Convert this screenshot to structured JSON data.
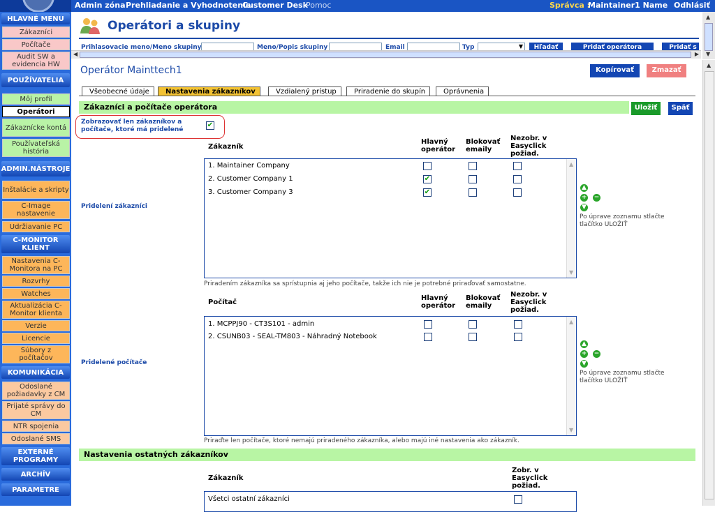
{
  "topbar": {
    "nav": [
      "Admin zóna",
      "Prehliadanie a Vyhodnotenie",
      "Customer Desk",
      "Pomoc"
    ],
    "admin_label": "Správca :",
    "admin_name": "Maintainer1 Name",
    "logout": "Odhlásiť"
  },
  "sidebar": {
    "hlavne_menu": "HLAVNÉ MENU",
    "zakaznici": "Zákazníci",
    "pocitace": "Počítače",
    "audit": "Audit SW a evidencia HW",
    "pouzivatelia": "POUŽÍVATELIA",
    "moj_profil": "Môj profil",
    "operatori": "Operátori",
    "zakaznicke_konta": "Zákaznícke kontá",
    "pouz_historia": "Používateľská história",
    "admin_nastroje": "ADMIN.NÁSTROJE",
    "instalacie": "Inštalácie a skripty",
    "cimage": "C-Image nastavenie",
    "udrziavanie": "Udržiavanie PC",
    "cmonitor_klient": "C-MONITOR KLIENT",
    "nastavenia_cm": "Nastavenia C-Monitora na PC",
    "rozvrhy": "Rozvrhy",
    "watches": "Watches",
    "aktualizacia": "Aktualizácia C-Monitor klienta",
    "verzie": "Verzie",
    "licencie": "Licencie",
    "subory": "Súbory z počítačov",
    "komunikacia": "KOMUNIKÁCIA",
    "odoslane_poziadavky": "Odoslané požiadavky z CM",
    "prijate_spravy": "Prijaté správy do CM",
    "ntr": "NTR spojenia",
    "odoslane_sms": "Odoslané SMS",
    "externe": "EXTERNÉ PROGRAMY",
    "archiv": "ARCHÍV",
    "parametre": "PARAMETRE"
  },
  "header": {
    "title": "Operátori a skupiny",
    "filter_login": "Prihlasovacie meno/Meno skupiny",
    "filter_name": "Meno/Popis skupiny",
    "filter_email": "Email",
    "filter_type": "Typ",
    "search_btn": "Hľadať",
    "add_operator_btn": "Pridať operátora",
    "add_group_btn": "Pridať s"
  },
  "operator": {
    "name": "Operátor Mainttech1",
    "copy_btn": "Kopírovať",
    "delete_btn": "Zmazať"
  },
  "tabs": [
    "Všeobecné údaje",
    "Nastavenia zákazníkov",
    "Vzdialený prístup",
    "Priradenie do skupín",
    "Oprávnenia"
  ],
  "section1": {
    "title": "Zákazníci a počítače operátora",
    "save_btn": "Uložiť",
    "back_btn": "Späť",
    "only_assigned_label": "Zobrazovať len zákazníkov a počítače, ktoré má pridelené",
    "only_assigned_checked": true
  },
  "customers": {
    "side_label": "Pridelení zákazníci",
    "col_name": "Zákazník",
    "col_main": "Hlavný operátor",
    "col_block": "Blokovať emaily",
    "col_hide": "Nezobr. v Easyclick požiad.",
    "rows": [
      {
        "name": "1. Maintainer Company",
        "main": false,
        "block": false,
        "hide": false
      },
      {
        "name": "2. Customer Company 1",
        "main": true,
        "block": false,
        "hide": false
      },
      {
        "name": "3. Customer Company 3",
        "main": true,
        "block": false,
        "hide": false
      }
    ],
    "hint": "Po úprave zoznamu stlačte tlačítko ULOŽIŤ",
    "note": "Priradením zákazníka sa sprístupnia aj jeho počítače, takže ich nie je potrebné priraďovať samostatne."
  },
  "computers": {
    "side_label": "Pridelené počítače",
    "col_name": "Počítač",
    "col_main": "Hlavný operátor",
    "col_block": "Blokovať emaily",
    "col_hide": "Nezobr. v Easyclick požiad.",
    "rows": [
      {
        "name": "1. MCPPJ90 - CT3S101 - admin",
        "main": false,
        "block": false,
        "hide": false
      },
      {
        "name": "2. CSUNB03 - SEAL-TM803 - Náhradný Notebook",
        "main": false,
        "block": false,
        "hide": false
      }
    ],
    "hint": "Po úprave zoznamu stlačte tlačítko ULOŽIŤ",
    "note": "Priraďte len počítače, ktoré nemajú priradeného zákazníka, alebo majú iné nastavenia ako zákazník."
  },
  "section2": {
    "title": "Nastavenia ostatných zákazníkov",
    "col_name": "Zákazník",
    "col_show": "Zobr. v Easyclick požiad.",
    "row": "Všetci ostatní zákazníci",
    "row_checked": false
  }
}
